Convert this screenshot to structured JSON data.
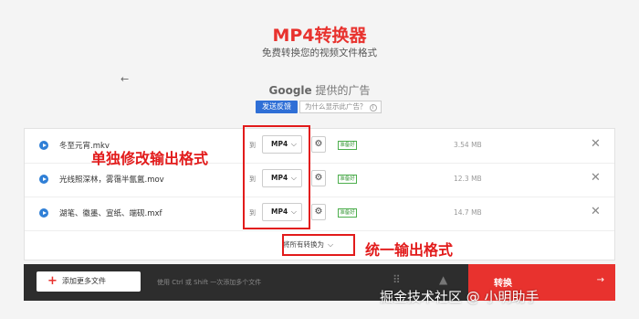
{
  "header": {
    "title": "MP4转换器",
    "subtitle": "免费转换您的视频文件格式",
    "back_icon": "←"
  },
  "ad": {
    "provider_brand": "Google",
    "provider_suffix": " 提供的广告",
    "feedback_label": "发送反馈",
    "why_label": "为什么显示此广告？",
    "info_icon": "i"
  },
  "files": [
    {
      "name": "冬至元宵.mkv",
      "to_label": "到",
      "format": "MP4",
      "status": "准备好",
      "size": "3.54 MB"
    },
    {
      "name": "光线照深林，雾霭半氤氲.mov",
      "to_label": "到",
      "format": "MP4",
      "status": "准备好",
      "size": "12.3 MB"
    },
    {
      "name": "湖笔、徽墨、宣纸、端砚.mxf",
      "to_label": "到",
      "format": "MP4",
      "status": "准备好",
      "size": "14.7 MB"
    }
  ],
  "icons": {
    "chevron": "⌵",
    "gear": "⚙",
    "close": "✕"
  },
  "convert_all": {
    "label": "将所有转换为"
  },
  "bottom_bar": {
    "add_label": "添加更多文件",
    "add_icon": "+",
    "hint": "使用 Ctrl 或 Shift 一次添加多个文件",
    "cloud_icon": "⠿",
    "drive_icon": "▲",
    "convert_label": "转换",
    "convert_arrow": "→"
  },
  "annotations": {
    "individual": "单独修改输出格式",
    "unified": "统一输出格式"
  },
  "watermark": "掘金技术社区 @ 小明助手",
  "colors": {
    "accent": "#e8322e",
    "annotation": "#e21b1b",
    "play": "#2f7fd6",
    "ready": "#4cae4c"
  }
}
